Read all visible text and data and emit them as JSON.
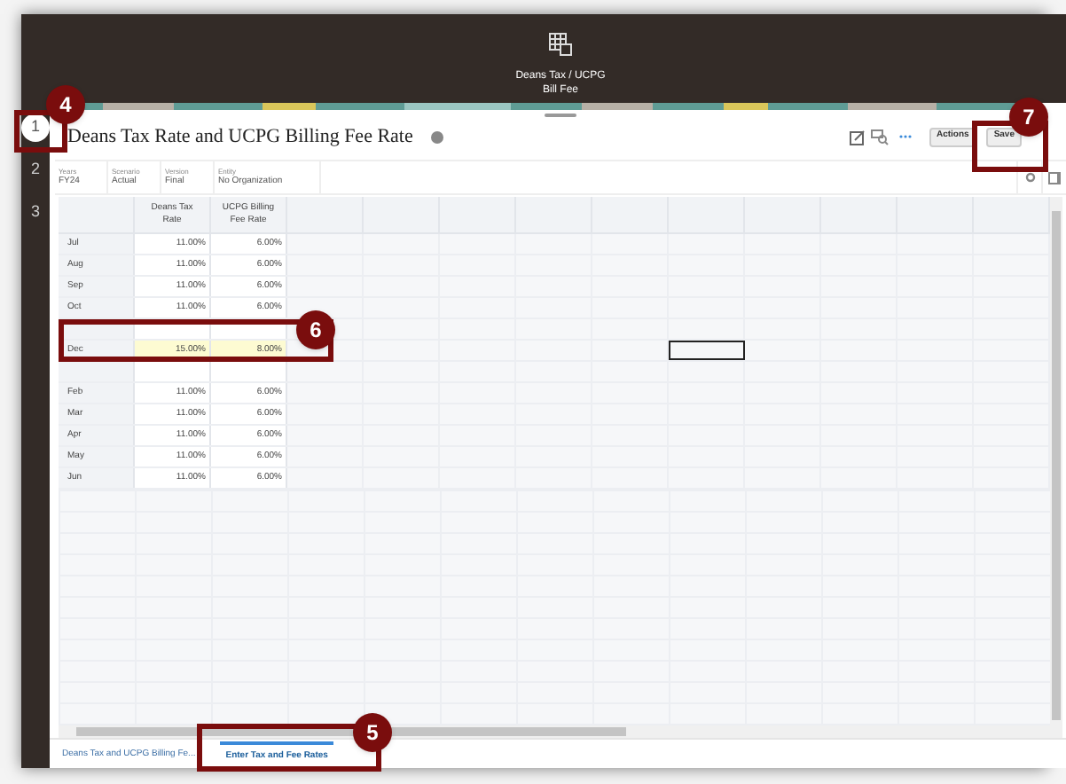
{
  "header": {
    "title_lines": [
      "Deans Tax / UCPG",
      "Bill Fee"
    ]
  },
  "steps": [
    {
      "label": "1",
      "selected": true
    },
    {
      "label": "2",
      "selected": false
    },
    {
      "label": "3",
      "selected": false
    }
  ],
  "form": {
    "title": "Deans Tax Rate and UCPG Billing Fee Rate",
    "buttons": [
      "Actions",
      "Save"
    ]
  },
  "pov": [
    {
      "label": "Years",
      "value": "FY24"
    },
    {
      "label": "Scenario",
      "value": "Actual"
    },
    {
      "label": "Version",
      "value": "Final"
    },
    {
      "label": "Entity",
      "value": "No Organization"
    }
  ],
  "columns": [
    "Deans Tax Rate",
    "UCPG Billing Fee Rate"
  ],
  "rows": [
    {
      "month": "Jul",
      "values": [
        "11.00%",
        "6.00%"
      ],
      "changed": false,
      "selected": false
    },
    {
      "month": "Aug",
      "values": [
        "11.00%",
        "6.00%"
      ],
      "changed": false,
      "selected": false
    },
    {
      "month": "Sep",
      "values": [
        "11.00%",
        "6.00%"
      ],
      "changed": false,
      "selected": false
    },
    {
      "month": "Oct",
      "values": [
        "11.00%",
        "6.00%"
      ],
      "changed": false,
      "selected": false
    },
    {
      "changed": false,
      "selected": false
    },
    {
      "month": "Dec",
      "values": [
        "15.00%",
        "8.00%"
      ],
      "changed": true,
      "selected": true
    },
    {
      "changed": false,
      "selected": false
    },
    {
      "month": "Feb",
      "values": [
        "11.00%",
        "6.00%"
      ],
      "changed": false,
      "selected": false
    },
    {
      "month": "Mar",
      "values": [
        "11.00%",
        "6.00%"
      ],
      "changed": false,
      "selected": false
    },
    {
      "month": "Apr",
      "values": [
        "11.00%",
        "6.00%"
      ],
      "changed": false,
      "selected": false
    },
    {
      "month": "May",
      "values": [
        "11.00%",
        "6.00%"
      ],
      "changed": false,
      "selected": false
    },
    {
      "month": "Jun",
      "values": [
        "11.00%",
        "6.00%"
      ],
      "changed": false,
      "selected": false
    }
  ],
  "tabs": [
    {
      "label": "Deans Tax and UCPG Billing Fe...",
      "selected": false
    },
    {
      "label": "Enter Tax and Fee Rates",
      "selected": true
    }
  ],
  "callouts": [
    {
      "number": "4",
      "kind": "step"
    },
    {
      "number": "7",
      "kind": "save"
    },
    {
      "number": "6",
      "kind": "row"
    },
    {
      "number": "5",
      "kind": "tab"
    }
  ]
}
